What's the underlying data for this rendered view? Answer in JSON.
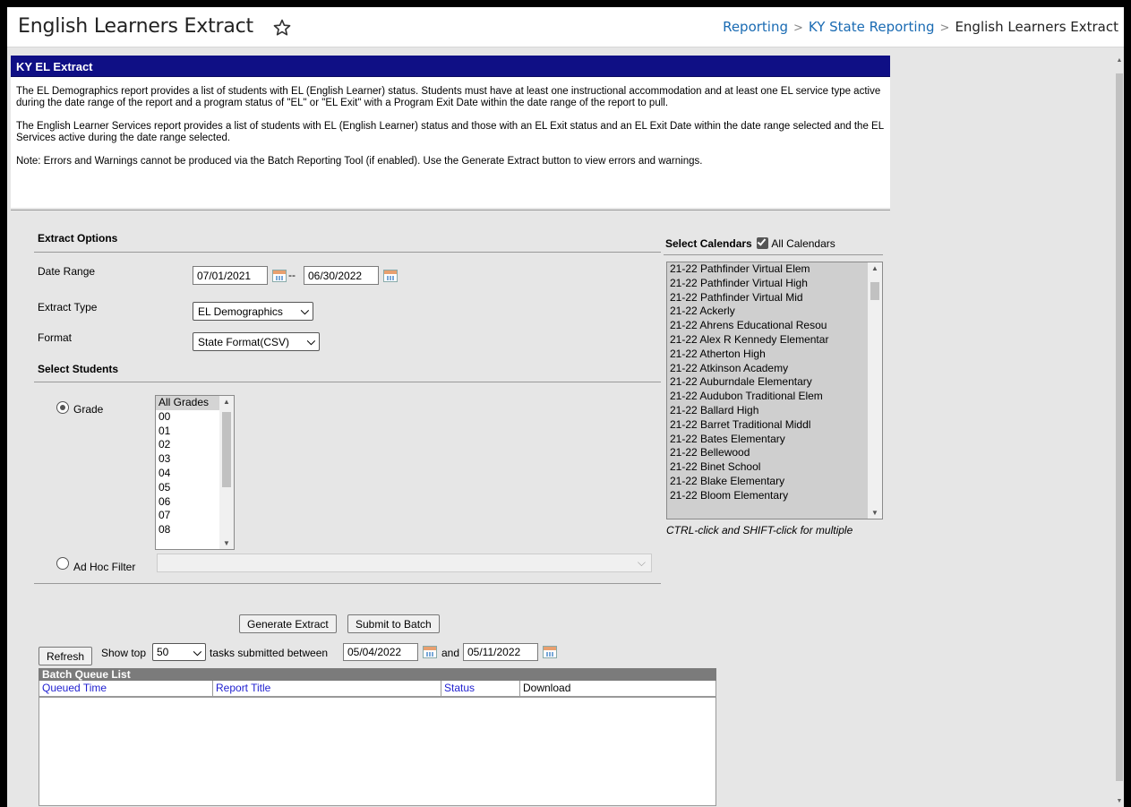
{
  "header": {
    "page_title": "English Learners Extract",
    "breadcrumb": [
      "Reporting",
      "KY State Reporting",
      "English Learners Extract"
    ]
  },
  "panel": {
    "title": "KY EL Extract",
    "desc_1": "The EL Demographics report provides a list of students with EL (English Learner) status. Students must have at least one instructional accommodation and at least one EL service type active during the date range of the report and a program status of \"EL\" or \"EL Exit\" with a Program Exit Date within the date range of the report to pull.",
    "desc_2": "The English Learner Services report provides a list of students with EL (English Learner) status and those with an EL Exit status and an EL Exit Date within the date range selected and the EL Services active during the date range selected.",
    "desc_3": "Note: Errors and Warnings cannot be produced via the Batch Reporting Tool (if enabled). Use the Generate Extract button to view errors and warnings."
  },
  "extract_options": {
    "title": "Extract Options",
    "date_range_label": "Date Range",
    "start_date": "07/01/2021",
    "date_sep": "--",
    "end_date": "06/30/2022",
    "extract_type_label": "Extract Type",
    "extract_type_value": "EL Demographics",
    "format_label": "Format",
    "format_value": "State Format(CSV)"
  },
  "select_students": {
    "title": "Select Students",
    "grade_label": "Grade",
    "grade_selected": true,
    "grades": [
      "All Grades",
      "00",
      "01",
      "02",
      "03",
      "04",
      "05",
      "06",
      "07",
      "08"
    ],
    "ad_hoc_label": "Ad Hoc Filter"
  },
  "calendars": {
    "title": "Select Calendars",
    "all_label": "All Calendars",
    "all_checked": true,
    "items": [
      "21-22 Pathfinder Virtual Elem",
      "21-22 Pathfinder Virtual High",
      "21-22 Pathfinder Virtual Mid",
      "21-22 Ackerly",
      "21-22 Ahrens Educational Resou",
      "21-22 Alex R Kennedy Elementar",
      "21-22 Atherton High",
      "21-22 Atkinson Academy",
      "21-22 Auburndale Elementary",
      "21-22 Audubon Traditional Elem",
      "21-22 Ballard High",
      "21-22 Barret Traditional Middl",
      "21-22 Bates Elementary",
      "21-22 Bellewood",
      "21-22 Binet School",
      "21-22 Blake Elementary",
      "21-22 Bloom Elementary"
    ],
    "hint": "CTRL-click and SHIFT-click for multiple"
  },
  "actions": {
    "generate": "Generate Extract",
    "submit_batch": "Submit to Batch"
  },
  "batch": {
    "refresh": "Refresh",
    "show_top": "Show top",
    "top_value": "50",
    "tasks_between": "tasks submitted between",
    "from_date": "05/04/2022",
    "and": "and",
    "to_date": "05/11/2022",
    "list_title": "Batch Queue List",
    "columns": [
      "Queued Time",
      "Report Title",
      "Status",
      "Download"
    ]
  }
}
